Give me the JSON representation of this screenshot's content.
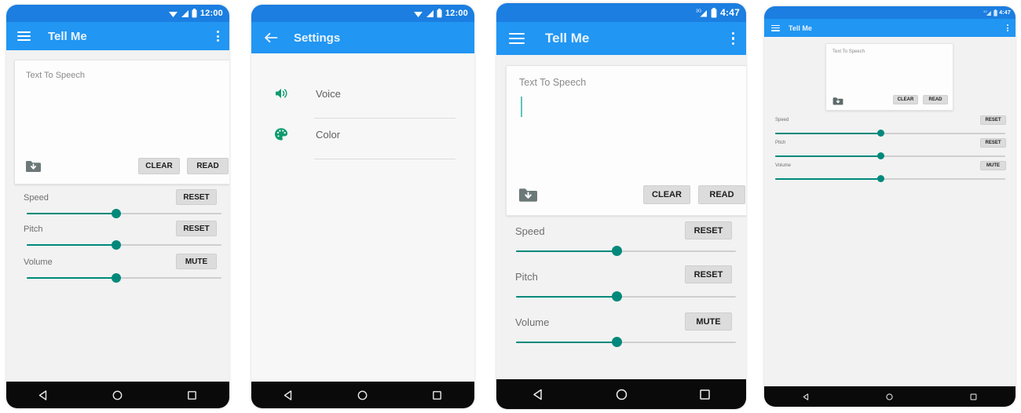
{
  "app": {
    "name": "Tell Me",
    "accent_blue": "#2196f3",
    "statusbar_blue": "#1b7ee0",
    "accent_teal": "#00897b",
    "icon_green": "#0e9b6e",
    "screen_bg": "#f2f2f2",
    "card_bg": "#fdfdfd",
    "button_bg": "#dcdcdc"
  },
  "panels": [
    {
      "id": "panel-main-phone",
      "kind": "phone",
      "statusbar": {
        "time": "12:00",
        "icons": [
          "wifi-icon",
          "signal-icon",
          "battery-icon"
        ]
      },
      "appbar": {
        "nav_icon": "hamburger-menu-icon",
        "title": "Tell Me",
        "overflow_icon": "overflow-menu-icon"
      },
      "card": {
        "hint": "Text To Speech",
        "value": "",
        "has_caret": false,
        "folder_icon": "folder-download-icon",
        "buttons": [
          {
            "name": "clear-button",
            "label": "CLEAR"
          },
          {
            "name": "read-button",
            "label": "READ"
          }
        ]
      },
      "sliders": [
        {
          "name": "speed",
          "label": "Speed",
          "action_label": "RESET",
          "value_pct": 46
        },
        {
          "name": "pitch",
          "label": "Pitch",
          "action_label": "RESET",
          "value_pct": 46
        },
        {
          "name": "volume",
          "label": "Volume",
          "action_label": "MUTE",
          "value_pct": 46
        }
      ],
      "navbar": {
        "back": "back-triangle-icon",
        "home": "home-circle-icon",
        "recents": "recents-square-icon"
      }
    },
    {
      "id": "panel-settings-phone",
      "kind": "phone",
      "statusbar": {
        "time": "12:00",
        "icons": [
          "wifi-icon",
          "signal-icon",
          "battery-icon"
        ]
      },
      "appbar": {
        "nav_icon": "back-arrow-icon",
        "title": "Settings",
        "overflow_icon": null
      },
      "settings_items": [
        {
          "name": "settings-item-voice",
          "icon": "speaker-volume-icon",
          "label": "Voice"
        },
        {
          "name": "settings-item-color",
          "icon": "color-palette-icon",
          "label": "Color"
        }
      ],
      "navbar": {
        "back": "back-triangle-icon",
        "home": "home-circle-icon",
        "recents": "recents-square-icon"
      }
    },
    {
      "id": "panel-main-phone-large",
      "kind": "phone",
      "statusbar": {
        "time": "4:47",
        "icons": [
          "3g-signal-icon",
          "battery-icon"
        ]
      },
      "appbar": {
        "nav_icon": "hamburger-menu-icon",
        "title": "Tell Me",
        "overflow_icon": "overflow-menu-icon"
      },
      "card": {
        "hint": "Text To Speech",
        "value": "",
        "has_caret": true,
        "folder_icon": "folder-download-icon",
        "buttons": [
          {
            "name": "clear-button",
            "label": "CLEAR"
          },
          {
            "name": "read-button",
            "label": "READ"
          }
        ]
      },
      "sliders": [
        {
          "name": "speed",
          "label": "Speed",
          "action_label": "RESET",
          "value_pct": 46
        },
        {
          "name": "pitch",
          "label": "Pitch",
          "action_label": "RESET",
          "value_pct": 46
        },
        {
          "name": "volume",
          "label": "Volume",
          "action_label": "MUTE",
          "value_pct": 46
        }
      ],
      "navbar": {
        "back": "back-triangle-icon",
        "home": "home-circle-icon",
        "recents": "recents-square-icon"
      }
    },
    {
      "id": "panel-main-tablet",
      "kind": "tablet",
      "statusbar": {
        "time": "4:47",
        "icons": [
          "3g-signal-icon",
          "battery-icon"
        ]
      },
      "appbar": {
        "nav_icon": "hamburger-menu-icon",
        "title": "Tell Me",
        "overflow_icon": "overflow-menu-icon"
      },
      "card": {
        "hint": "Text To Speech",
        "value": "",
        "has_caret": false,
        "folder_icon": "folder-download-icon",
        "buttons": [
          {
            "name": "clear-button",
            "label": "CLEAR"
          },
          {
            "name": "read-button",
            "label": "READ"
          }
        ]
      },
      "sliders": [
        {
          "name": "speed",
          "label": "Speed",
          "action_label": "RESET",
          "value_pct": 46
        },
        {
          "name": "pitch",
          "label": "Pitch",
          "action_label": "RESET",
          "value_pct": 46
        },
        {
          "name": "volume",
          "label": "Volume",
          "action_label": "MUTE",
          "value_pct": 46
        }
      ],
      "navbar": {
        "back": "back-triangle-icon",
        "home": "home-circle-icon",
        "recents": "recents-square-icon"
      }
    }
  ]
}
